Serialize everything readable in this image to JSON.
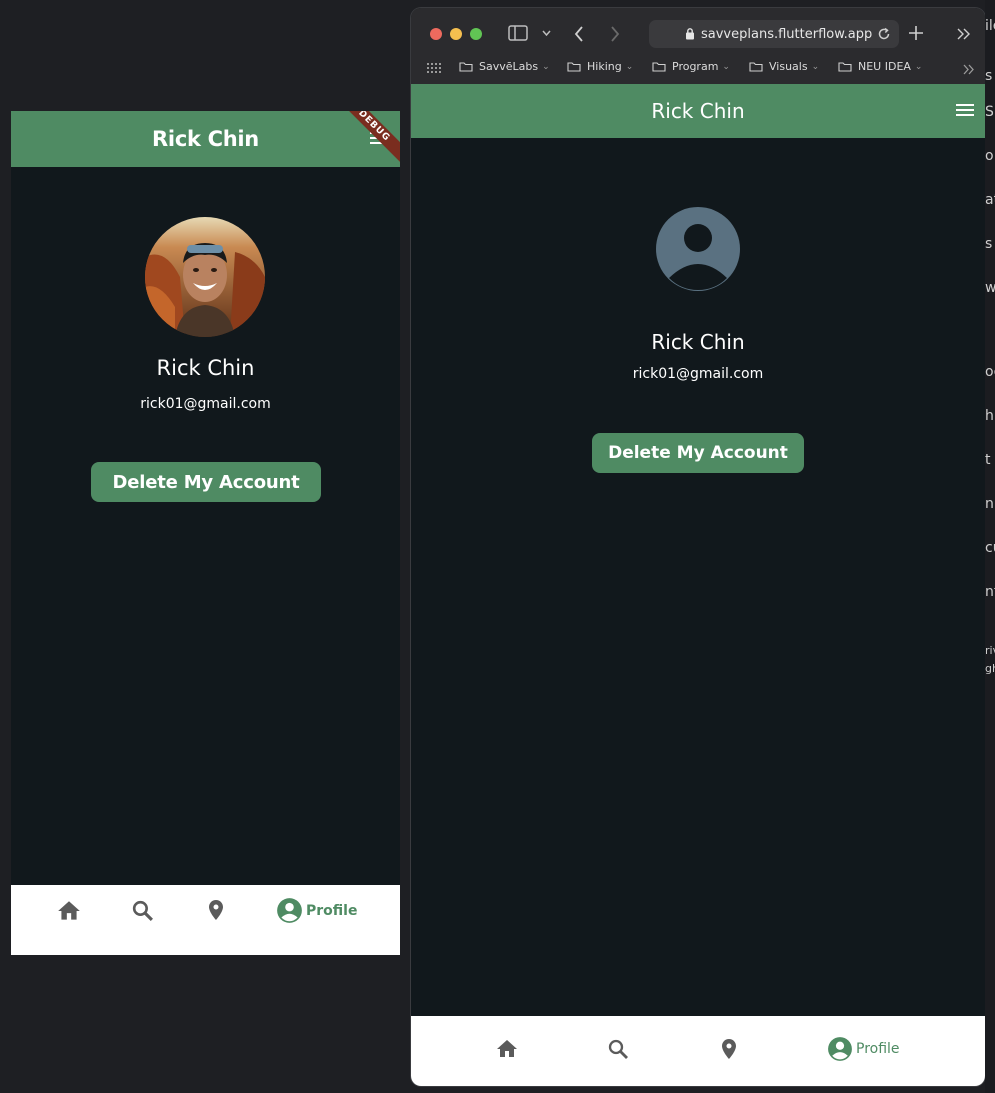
{
  "emulator": {
    "appbar_title": "Rick Chin",
    "debug_banner": "DEBUG",
    "user_name": "Rick Chin",
    "user_email": "rick01@gmail.com",
    "delete_label": "Delete My Account",
    "nav": {
      "home_icon": "home-icon",
      "search_icon": "search-icon",
      "location_icon": "location-pin-icon",
      "profile_label": "Profile"
    }
  },
  "browser": {
    "url": "savveplans.flutterflow.app",
    "bookmarks": [
      "SavvēLabs",
      "Hiking",
      "Program",
      "Visuals",
      "NEU IDEA"
    ],
    "app": {
      "appbar_title": "Rick Chin",
      "user_name": "Rick Chin",
      "user_email": "rick01@gmail.com",
      "delete_label": "Delete My Account",
      "profile_label": "Profile"
    }
  },
  "background_fragments": [
    "ile",
    "s",
    "S",
    "o",
    "at",
    "s",
    "w",
    "oc",
    "hl",
    "t",
    "nn",
    "cu",
    "nt",
    "riv",
    "gh"
  ],
  "colors": {
    "accent": "#4f8b63",
    "app_background": "#11181c",
    "desktop_background": "#1e1f23",
    "nav_inactive": "#5b5b5b"
  }
}
